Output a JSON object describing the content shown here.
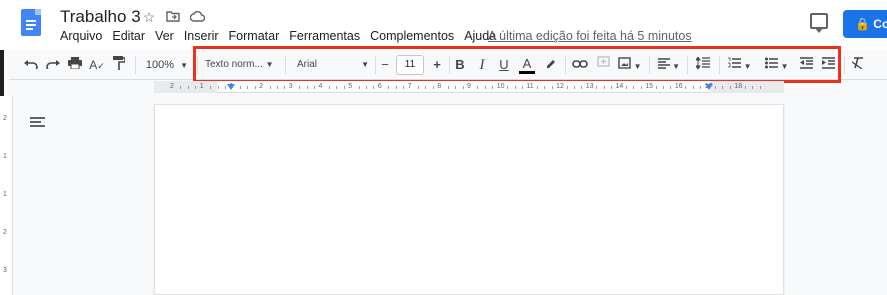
{
  "header": {
    "title": "Trabalho 3",
    "last_edit": "A última edição foi feita há 5 minutos",
    "share_label": "Co"
  },
  "menu": [
    "Arquivo",
    "Editar",
    "Ver",
    "Inserir",
    "Formatar",
    "Ferramentas",
    "Complementos",
    "Ajuda"
  ],
  "toolbar": {
    "zoom": "100%",
    "style": "Texto norm...",
    "font": "Arial",
    "font_size": "11",
    "minus": "−",
    "plus": "+",
    "bold": "B",
    "italic": "I",
    "underline": "U",
    "text_color": "A"
  },
  "ruler": {
    "numbers": [
      "2",
      "1",
      "1",
      "2",
      "3",
      "4",
      "5",
      "6",
      "7",
      "8",
      "9",
      "10",
      "11",
      "12",
      "13",
      "14",
      "15",
      "16",
      "17",
      "18"
    ]
  },
  "vruler": {
    "numbers": [
      "2",
      "1",
      "1",
      "2",
      "3"
    ]
  },
  "colors": {
    "accent": "#1a73e8",
    "doc_icon": "#4285f4",
    "highlight_border": "#e8331c"
  }
}
